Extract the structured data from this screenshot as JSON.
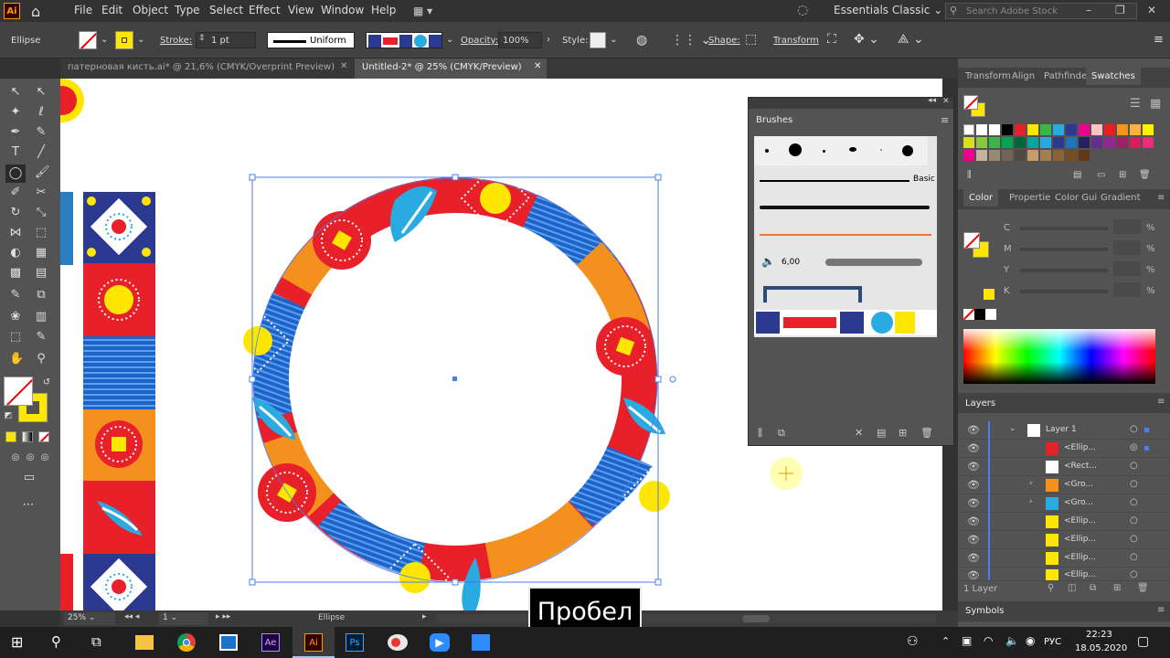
{
  "menubar": {
    "logo": "Ai",
    "items": [
      "File",
      "Edit",
      "Object",
      "Type",
      "Select",
      "Effect",
      "View",
      "Window",
      "Help"
    ],
    "workspace": "Essentials Classic",
    "search_placeholder": "Search Adobe Stock"
  },
  "control": {
    "object_type": "Ellipse",
    "stroke_label": "Stroke:",
    "stroke_value": "1 pt",
    "profile": "Uniform",
    "opacity_label": "Opacity:",
    "opacity_value": "100%",
    "style_label": "Style:",
    "shape_label": "Shape:",
    "transform_label": "Transform"
  },
  "tabs": [
    {
      "label": "патерновая кисть.ai* @ 21,6% (CMYK/Overprint Preview)"
    },
    {
      "label": "Untitled-2* @ 25% (CMYK/Preview)"
    }
  ],
  "status": {
    "zoom": "25%",
    "artboard": "1",
    "tool": "Ellipse"
  },
  "brushes": {
    "title": "Brushes",
    "basic": "Basic",
    "size": "6,00"
  },
  "right_tabs": [
    "Transform",
    "Align",
    "Pathfinde",
    "Swatches"
  ],
  "color_tabs": [
    "Color",
    "Propertie",
    "Color Gui",
    "Gradient"
  ],
  "color": {
    "labels": [
      "C",
      "M",
      "Y",
      "K"
    ],
    "unit": "%"
  },
  "layers": {
    "title": "Layers",
    "count": "1 Layer",
    "items": [
      "Layer 1",
      "<Ellip...",
      "<Rect...",
      "<Gro...",
      "<Gro...",
      "<Ellip...",
      "<Ellip...",
      "<Ellip...",
      "<Ellip..."
    ]
  },
  "symbols": {
    "title": "Symbols"
  },
  "subtitle": "Пробел",
  "taskbar": {
    "lang": "РУС",
    "time": "22:23",
    "date": "18.05.2020"
  },
  "colors": {
    "red": "#e8202a",
    "orange": "#f4911e",
    "blue": "#1e63c8",
    "yellow": "#ffe600",
    "navy": "#2b3990",
    "cyan": "#29aae1"
  }
}
